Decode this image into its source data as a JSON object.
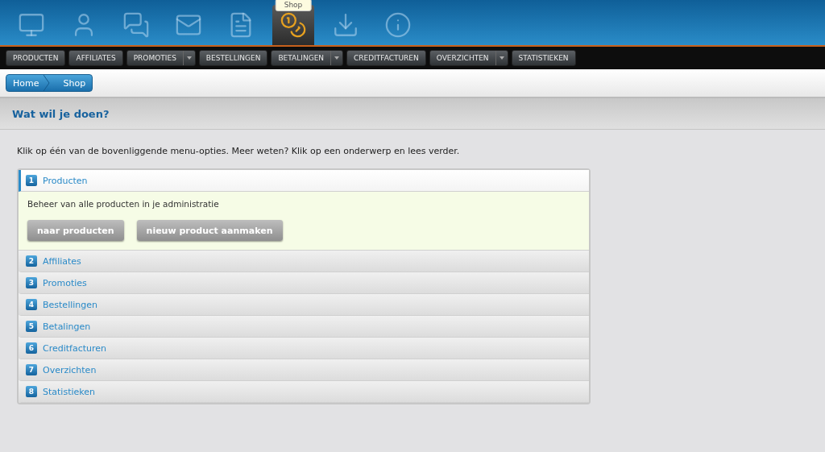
{
  "top_icons": [
    {
      "kind": "monitor",
      "selected": false
    },
    {
      "kind": "user",
      "selected": false
    },
    {
      "kind": "chat",
      "selected": false
    },
    {
      "kind": "mail",
      "selected": false
    },
    {
      "kind": "document",
      "selected": false
    },
    {
      "kind": "coins",
      "selected": true,
      "tooltip": "Shop"
    },
    {
      "kind": "download",
      "selected": false
    },
    {
      "kind": "info",
      "selected": false
    }
  ],
  "menu": [
    {
      "label": "PRODUCTEN",
      "dropdown": false
    },
    {
      "label": "AFFILIATES",
      "dropdown": false
    },
    {
      "label": "PROMOTIES",
      "dropdown": true
    },
    {
      "label": "BESTELLINGEN",
      "dropdown": false
    },
    {
      "label": "BETALINGEN",
      "dropdown": true
    },
    {
      "label": "CREDITFACTUREN",
      "dropdown": false
    },
    {
      "label": "OVERZICHTEN",
      "dropdown": true
    },
    {
      "label": "STATISTIEKEN",
      "dropdown": false
    }
  ],
  "breadcrumb": [
    "Home",
    "Shop"
  ],
  "heading": "Wat wil je doen?",
  "intro": "Klik op één van de bovenliggende menu-opties. Meer weten? Klik op een onderwerp en lees verder.",
  "sections": [
    {
      "number": "1",
      "title": "Producten",
      "expanded": true,
      "description": "Beheer van alle producten in je administratie",
      "buttons": [
        "naar producten",
        "nieuw product aanmaken"
      ]
    },
    {
      "number": "2",
      "title": "Affiliates",
      "expanded": false
    },
    {
      "number": "3",
      "title": "Promoties",
      "expanded": false
    },
    {
      "number": "4",
      "title": "Bestellingen",
      "expanded": false
    },
    {
      "number": "5",
      "title": "Betalingen",
      "expanded": false
    },
    {
      "number": "6",
      "title": "Creditfacturen",
      "expanded": false
    },
    {
      "number": "7",
      "title": "Overzichten",
      "expanded": false
    },
    {
      "number": "8",
      "title": "Statistieken",
      "expanded": false
    }
  ]
}
